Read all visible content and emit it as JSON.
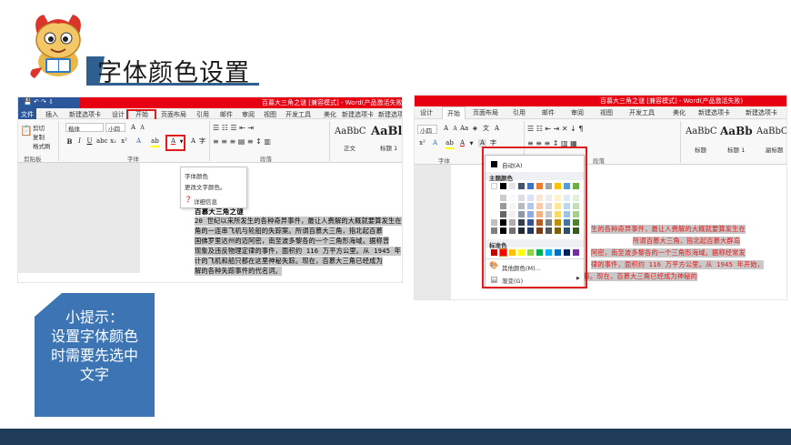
{
  "slide": {
    "title": "字体颜色设置",
    "tip_lines": [
      "小提示：",
      "设置字体颜色",
      "时需要先选中",
      "文字"
    ],
    "colors": {
      "accent_blue": "#2f5f8f",
      "dark_blue": "#1f3c5a",
      "tip_blue": "#3d75b4",
      "highlight_red": "#e01b1b"
    },
    "mascot_icon": "dragon-mascot-icon"
  },
  "left_window": {
    "title": "百慕大三角之谜 [兼容模式] - Word(产品激活失败)",
    "tabs": [
      "文件",
      "插入",
      "新建选项卡",
      "设计",
      "开始",
      "页面布局",
      "引用",
      "邮件",
      "审阅",
      "视图",
      "开发工具",
      "美化",
      "新建选项卡",
      "新建选项卡"
    ],
    "clipboard": {
      "cut": "剪切",
      "copy": "复制",
      "format_painter": "格式刷",
      "label": "剪贴板"
    },
    "font_name": "楷体",
    "font_size": "小四",
    "font_group_label": "字体",
    "paragraph_group_label": "段落",
    "styles": [
      {
        "sample": "AaBbC",
        "name": "正文"
      },
      {
        "sample": "AaBl",
        "name": "标题 1"
      }
    ],
    "tooltip": {
      "title": "字体颜色",
      "description": "更改文字颜色。",
      "more": "详细信息"
    },
    "doc_heading": "百慕大三角之谜",
    "doc_lines": [
      "20 世纪以来所发生的各种奇异事件，最让人费解的大概就要算发生在",
      "角的一连串飞机与轮船的失踪案。所谓百慕大三角，指北起百慕",
      "国佛罗里达州的迈阿密，南至波多黎各的一个三角形海域。据称曾",
      "现象及违反物理定律的事件，面积约 116 万平方公里。从 1945 年",
      "计的飞机和船只都在这里神秘失踪。现在，百慕大三角已经成为",
      "解的各种失踪事件的代名词。"
    ]
  },
  "right_window": {
    "title": "百慕大三角之谜 [兼容模式] - Word(产品激活失败)",
    "tabs": [
      "设计",
      "开始",
      "页面布局",
      "引用",
      "邮件",
      "审阅",
      "视图",
      "开发工具",
      "美化",
      "新建选项卡",
      "新建选项卡"
    ],
    "font_size": "小四",
    "font_group_label": "字体",
    "paragraph_group_label": "段落",
    "styles": [
      {
        "sample": "AaBbC",
        "name": "标题"
      },
      {
        "sample": "AaBb",
        "name": "标题 1"
      },
      {
        "sample": "AaBbC",
        "name": "副标题"
      }
    ],
    "palette": {
      "auto_label": "自动(A)",
      "theme_colors_label": "主题颜色",
      "theme_top": [
        "#ffffff",
        "#000000",
        "#e7e6e6",
        "#44546a",
        "#4472c4",
        "#ed7d31",
        "#a5a5a5",
        "#ffc000",
        "#5b9bd5",
        "#70ad47"
      ],
      "standard_colors_label": "标准色",
      "standard": [
        "#c00000",
        "#ff0000",
        "#ffc000",
        "#ffff00",
        "#92d050",
        "#00b050",
        "#00b0f0",
        "#0070c0",
        "#002060",
        "#7030a0"
      ],
      "more_colors_label": "其他颜色(M)...",
      "gradient_label": "渐变(G)"
    },
    "doc_lines": [
      "生的各种奇异事件，最让人费解的大概就要算发生在",
      "所谓百慕大三角，指北起百慕大群岛",
      "阿密，南至波多黎各的一个三角形海域。据称经常发",
      "律的事件，面积约 116 万平方公里。从 1945 年开始，",
      "计的飞机和船只都在这里神秘失踪。现在，百慕大三角已经成为神秘的"
    ]
  }
}
